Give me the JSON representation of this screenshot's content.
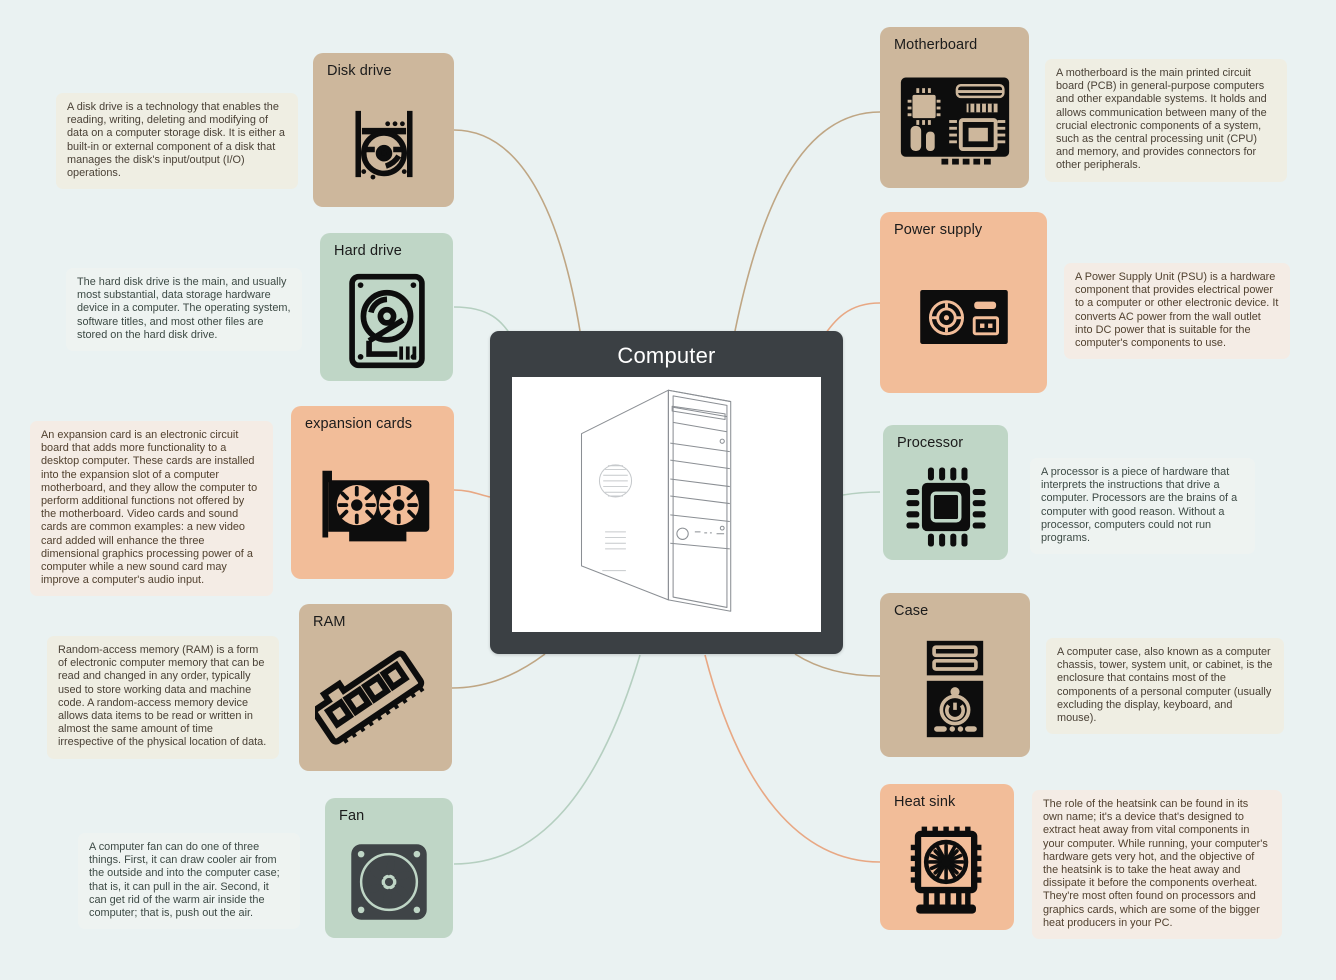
{
  "diagram": {
    "background_color": "#eaf2f2",
    "title": "Computer components mind map"
  },
  "center": {
    "label": "Computer",
    "background_color": "#3b4044",
    "text_color": "#ffffff",
    "image_name": "computer-tower-illustration"
  },
  "palette": {
    "tan": "#cdb79c",
    "green": "#bfd6c6",
    "peach": "#f2bd99",
    "note_tan": "#efeee3",
    "note_green": "#eef3f1",
    "note_peach": "#f4ece5",
    "link_tan": "#bfa684",
    "link_green": "#b5cfc0",
    "link_peach": "#e8a884"
  },
  "nodes": [
    {
      "id": "disk-drive",
      "label": "Disk drive",
      "color": "tan",
      "icon": "disk-drive-icon",
      "note": "A disk drive is a technology that enables the reading, writing, deleting and modifying of data on a computer storage disk. It is either a built-in or external component of a disk that manages the disk's input/output (I/O) operations."
    },
    {
      "id": "hard-drive",
      "label": "Hard drive",
      "color": "green",
      "icon": "hard-drive-icon",
      "note": "The hard disk drive is the main, and usually most substantial, data storage hardware device in a computer. The operating system, software titles, and most other files are stored on the hard disk drive."
    },
    {
      "id": "expansion-cards",
      "label": "expansion cards",
      "color": "peach",
      "icon": "graphics-card-icon",
      "note": "An expansion card is an electronic circuit board that adds more functionality to a desktop computer. These cards are installed into the expansion slot of a computer motherboard, and they allow the computer to perform additional functions not offered by the motherboard. Video cards and sound cards are common examples: a new video card added will enhance the three dimensional graphics processing power of a computer while a new sound card may improve a computer's audio input."
    },
    {
      "id": "ram",
      "label": "RAM",
      "color": "tan",
      "icon": "ram-stick-icon",
      "note": "Random-access memory (RAM) is a form of electronic computer memory that can be read and changed in any order, typically used to store working data and machine code. A random-access memory device allows data items to be read or written in almost the same amount of time irrespective of the physical location of data."
    },
    {
      "id": "fan",
      "label": "Fan",
      "color": "green",
      "icon": "case-fan-icon",
      "note": "A computer fan can do one of three things. First, it can draw cooler air from the outside and into the computer case; that is, it can pull in the air. Second, it can get rid of the warm air inside the computer; that is, push out the air."
    },
    {
      "id": "motherboard",
      "label": "Motherboard",
      "color": "tan",
      "icon": "motherboard-icon",
      "note": " A motherboard is the main printed circuit board (PCB) in general-purpose computers and other expandable systems. It holds and allows communication between many of the crucial electronic components of a system, such as the central processing unit (CPU) and memory, and provides connectors for other peripherals."
    },
    {
      "id": "power-supply",
      "label": "Power supply",
      "color": "peach",
      "icon": "power-supply-icon",
      "note": "A Power Supply Unit (PSU) is a hardware component that provides electrical power to a computer or other electronic device. It converts AC power from the wall outlet into DC power that is suitable for the computer's components to use."
    },
    {
      "id": "processor",
      "label": "Processor",
      "color": "green",
      "icon": "cpu-chip-icon",
      "note": "A processor is a piece of hardware that interprets the instructions that drive a computer. Processors are the brains of a computer with good reason. Without a processor, computers could not run programs."
    },
    {
      "id": "case",
      "label": "Case",
      "color": "tan",
      "icon": "computer-case-icon",
      "note": "A computer case, also known as a computer chassis, tower, system unit, or cabinet, is the enclosure that contains most of the components of a personal computer (usually excluding the display, keyboard, and mouse)."
    },
    {
      "id": "heat-sink",
      "label": "Heat sink",
      "color": "peach",
      "icon": "heatsink-icon",
      "note": "The role of the heatsink can be found in its own name; it's a device that's designed to extract heat away from vital components in your computer. While running, your computer's hardware gets very hot, and the objective of the heatsink is to take the heat away and dissipate it before the components overheat. They're most often found on processors and graphics cards, which are some of the bigger heat producers in your PC."
    }
  ]
}
